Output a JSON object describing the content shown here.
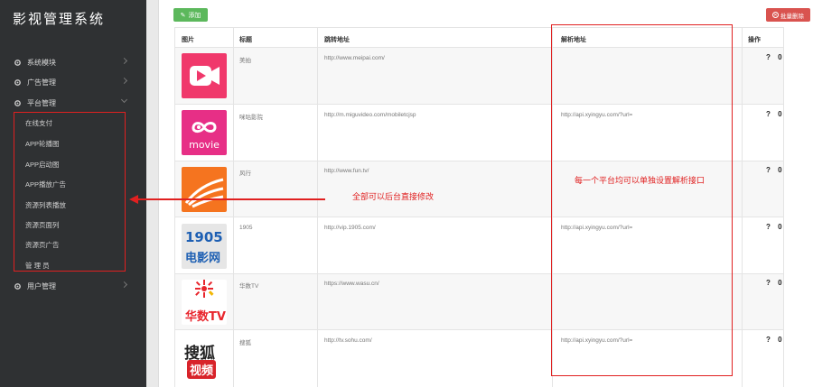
{
  "app_title": "影视管理系统",
  "sidebar": {
    "groups": [
      {
        "label": "系统模块",
        "icon": "cog-icon"
      },
      {
        "label": "广告管理",
        "icon": "cog-icon"
      },
      {
        "label": "平台管理",
        "icon": "cog-icon"
      },
      {
        "label": "用户管理",
        "icon": "cog-icon"
      }
    ],
    "sub_items": [
      {
        "label": "在线支付"
      },
      {
        "label": "APP轮播图"
      },
      {
        "label": "APP启动图"
      },
      {
        "label": "APP播放广告"
      },
      {
        "label": "资源列表播放"
      },
      {
        "label": "资源页面列"
      },
      {
        "label": "资源页广告"
      },
      {
        "label": "管 理 员"
      }
    ]
  },
  "toolbar": {
    "add_label": "添加",
    "batch_delete_label": "批量删除"
  },
  "table": {
    "headers": {
      "image": "图片",
      "title": "标题",
      "jump_url": "跳转地址",
      "parse_url": "解析地址",
      "ops": "操作"
    },
    "rows": [
      {
        "logo": "meipai-logo",
        "title": "美拍",
        "jump_url": "http://www.meipai.com/",
        "parse_url": "",
        "ops": "? 0"
      },
      {
        "logo": "migu-movie-logo",
        "title": "咪咕影院",
        "jump_url": "http://m.miguvideo.com/mobiletcjsp",
        "parse_url": "http://api.xyingyu.com/?url=",
        "ops": "? 0"
      },
      {
        "logo": "fengxing-logo",
        "title": "风行",
        "jump_url": "http://www.fun.tv/",
        "parse_url": "",
        "ops": "? 0"
      },
      {
        "logo": "m1905-logo",
        "title": "1905",
        "jump_url": "http://vip.1905.com/",
        "parse_url": "http://api.xyingyu.com/?url=",
        "ops": "? 0"
      },
      {
        "logo": "huashu-tv-logo",
        "title": "华数TV",
        "jump_url": "https://www.wasu.cn/",
        "parse_url": "",
        "ops": "? 0"
      },
      {
        "logo": "sohu-video-logo",
        "title": "搜狐",
        "jump_url": "http://tv.sohu.com/",
        "parse_url": "http://api.xyingyu.com/?url=",
        "ops": "? 0"
      }
    ],
    "logo_text": {
      "m1905_line1": "1905",
      "m1905_line2": "电影网",
      "huashu": "华数TV",
      "sohu_line1": "搜狐",
      "sohu_line2": "视频",
      "migu": "movie"
    }
  },
  "annotations": {
    "left_note": "全部可以后台直接修改",
    "right_note": "每一个平台均可以单独设置解析接口",
    "color": "#e02020"
  }
}
